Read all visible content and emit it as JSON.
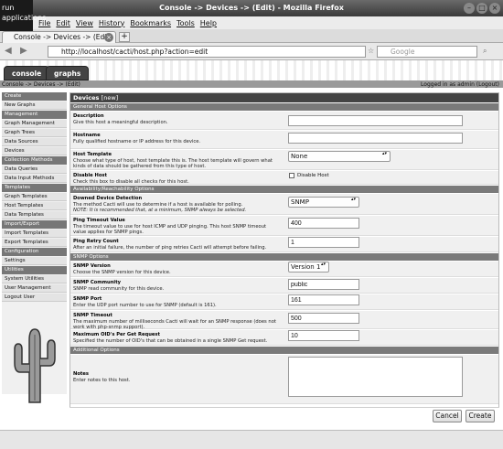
{
  "window": {
    "title": "Console -> Devices -> (Edit) - Mozilla Firefox",
    "run_label": "run applications"
  },
  "menu": {
    "items": [
      "File",
      "Edit",
      "View",
      "History",
      "Bookmarks",
      "Tools",
      "Help"
    ]
  },
  "tab": {
    "title": "Console -> Devices -> (Edit)"
  },
  "nav": {
    "url": "http://localhost/cacti/host.php?action=edit",
    "search_placeholder": "Google"
  },
  "cacti": {
    "tabs": [
      "console",
      "graphs"
    ],
    "breadcrumb": "Console -> Devices -> (Edit)",
    "login": "Logged in as admin (Logout)"
  },
  "sidebar": [
    {
      "type": "header",
      "label": "Create"
    },
    {
      "type": "item",
      "label": "New Graphs"
    },
    {
      "type": "header",
      "label": "Management"
    },
    {
      "type": "item",
      "label": "Graph Management"
    },
    {
      "type": "item",
      "label": "Graph Trees"
    },
    {
      "type": "item",
      "label": "Data Sources"
    },
    {
      "type": "item",
      "label": "Devices"
    },
    {
      "type": "header",
      "label": "Collection Methods"
    },
    {
      "type": "item",
      "label": "Data Queries"
    },
    {
      "type": "item",
      "label": "Data Input Methods"
    },
    {
      "type": "header",
      "label": "Templates"
    },
    {
      "type": "item",
      "label": "Graph Templates"
    },
    {
      "type": "item",
      "label": "Host Templates"
    },
    {
      "type": "item",
      "label": "Data Templates"
    },
    {
      "type": "header",
      "label": "Import/Export"
    },
    {
      "type": "item",
      "label": "Import Templates"
    },
    {
      "type": "item",
      "label": "Export Templates"
    },
    {
      "type": "header",
      "label": "Configuration"
    },
    {
      "type": "item",
      "label": "Settings"
    },
    {
      "type": "header",
      "label": "Utilities"
    },
    {
      "type": "item",
      "label": "System Utilities"
    },
    {
      "type": "item",
      "label": "User Management"
    },
    {
      "type": "item",
      "label": "Logout User"
    }
  ],
  "form": {
    "heading": "Devices",
    "heading_tag": "[new]",
    "sections": {
      "general": "General Host Options",
      "avail": "Availability/Reachability Options",
      "snmp": "SNMP Options",
      "additional": "Additional Options"
    },
    "description": {
      "title": "Description",
      "desc": "Give this host a meaningful description.",
      "value": ""
    },
    "hostname": {
      "title": "Hostname",
      "desc": "Fully qualified hostname or IP address for this device.",
      "value": ""
    },
    "host_template": {
      "title": "Host Template",
      "desc": "Choose what type of host, host template this is. The host template will govern what kinds of data should be gathered from this type of host.",
      "value": "None"
    },
    "disable_host": {
      "title": "Disable Host",
      "desc": "Check this box to disable all checks for this host.",
      "label": "Disable Host"
    },
    "downed": {
      "title": "Downed Device Detection",
      "desc": "The method Cacti will use to determine if a host is available for polling.",
      "note": "NOTE: It is recommended that, at a minimum, SNMP always be selected.",
      "value": "SNMP"
    },
    "ping_timeout": {
      "title": "Ping Timeout Value",
      "desc": "The timeout value to use for host ICMP and UDP pinging. This host SNMP timeout value applies for SNMP pings.",
      "value": "400"
    },
    "ping_retry": {
      "title": "Ping Retry Count",
      "desc": "After an initial failure, the number of ping retries Cacti will attempt before failing.",
      "value": "1"
    },
    "snmp_version": {
      "title": "SNMP Version",
      "desc": "Choose the SNMP version for this device.",
      "value": "Version 1"
    },
    "snmp_community": {
      "title": "SNMP Community",
      "desc": "SNMP read community for this device.",
      "value": "public"
    },
    "snmp_port": {
      "title": "SNMP Port",
      "desc": "Enter the UDP port number to use for SNMP (default is 161).",
      "value": "161"
    },
    "snmp_timeout": {
      "title": "SNMP Timeout",
      "desc": "The maximum number of milliseconds Cacti will wait for an SNMP response (does not work with php-snmp support).",
      "value": "500"
    },
    "max_oids": {
      "title": "Maximum OID's Per Get Request",
      "desc": "Specified the number of OID's that can be obtained in a single SNMP Get request.",
      "value": "10"
    },
    "notes": {
      "title": "Notes",
      "desc": "Enter notes to this host.",
      "value": ""
    },
    "cancel_label": "Cancel",
    "create_label": "Create"
  }
}
